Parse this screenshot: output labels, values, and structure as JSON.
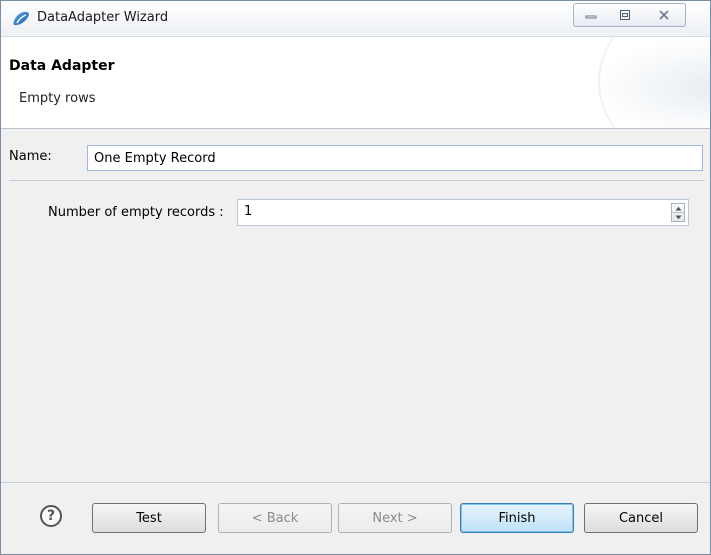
{
  "window": {
    "title": "DataAdapter Wizard",
    "controls": {
      "minimize_icon": "minimize-icon",
      "maximize_icon": "restore-icon",
      "close_icon": "close-icon"
    }
  },
  "banner": {
    "title": "Data Adapter",
    "subtitle": "Empty rows"
  },
  "form": {
    "name_label": "Name:",
    "name_value": "One Empty Record",
    "records_label": "Number of empty records :",
    "records_value": "1"
  },
  "buttons": {
    "help_icon": "help-icon",
    "test": "Test",
    "back": "< Back",
    "next": "Next >",
    "finish": "Finish",
    "cancel": "Cancel"
  },
  "colors": {
    "accent_default_button": "#bde1f7",
    "input_border_focus": "#9fbbdc"
  }
}
